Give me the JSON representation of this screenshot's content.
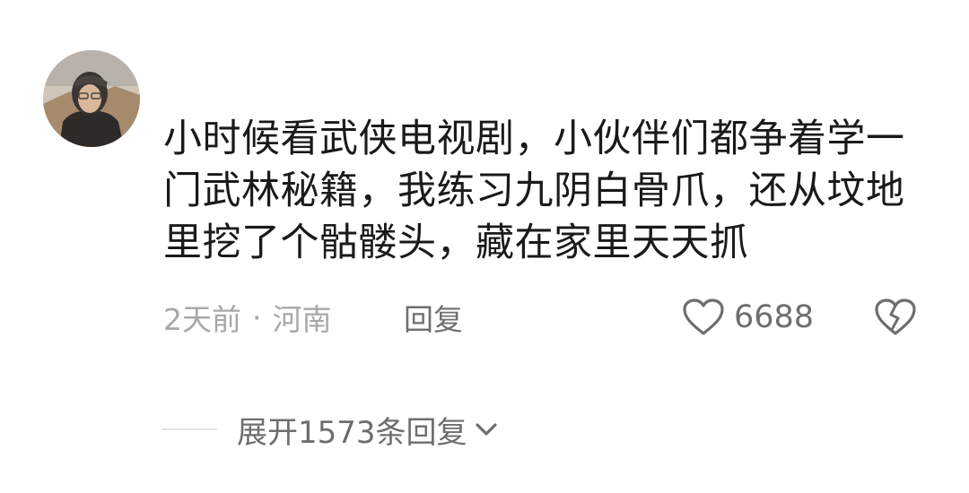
{
  "comment": {
    "avatar_icon": "user-avatar-photo",
    "text": "小时候看武侠电视剧，小伙伴们都争着学一门武林秘籍，我练习九阴白骨爪，还从坟地里挖了个骷髅头，藏在家里天天抓",
    "time": "2天前",
    "separator": "·",
    "location": "河南",
    "reply_label": "回复",
    "like_icon": "heart-outline-icon",
    "like_count": "6688",
    "dislike_icon": "broken-heart-icon"
  },
  "replies": {
    "expand_label": "展开1573条回复",
    "expand_icon": "chevron-down-icon"
  }
}
